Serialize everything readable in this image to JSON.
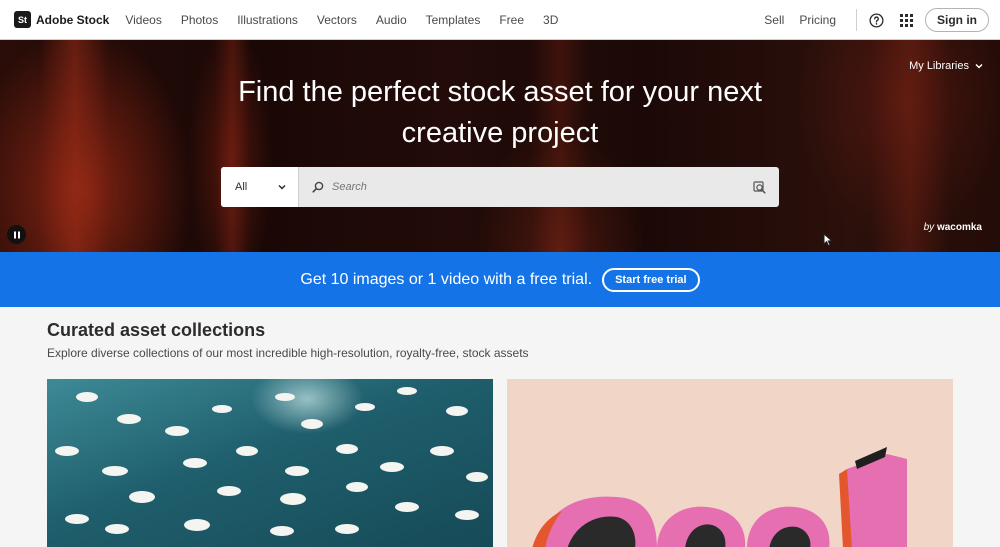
{
  "header": {
    "logo_mark": "St",
    "logo_text": "Adobe Stock",
    "nav": [
      "Videos",
      "Photos",
      "Illustrations",
      "Vectors",
      "Audio",
      "Templates",
      "Free",
      "3D"
    ],
    "sell": "Sell",
    "pricing": "Pricing",
    "help_icon": "help-circle-icon",
    "apps_icon": "app-grid-icon",
    "sign_in": "Sign in"
  },
  "hero": {
    "title_line1": "Find the perfect stock asset for your next",
    "title_line2": "creative project",
    "my_libraries": "My Libraries",
    "search": {
      "category": "All",
      "placeholder": "Search",
      "visual_search_icon": "visual-search-icon"
    },
    "credit_prefix": "by",
    "credit_name": "wacomka"
  },
  "banner": {
    "text": "Get 10 images or 1 video with a free trial.",
    "button": "Start free trial",
    "color": "#1473e6"
  },
  "curated": {
    "title": "Curated asset collections",
    "subtitle": "Explore diverse collections of our most incredible high-resolution, royalty-free, stock assets"
  }
}
